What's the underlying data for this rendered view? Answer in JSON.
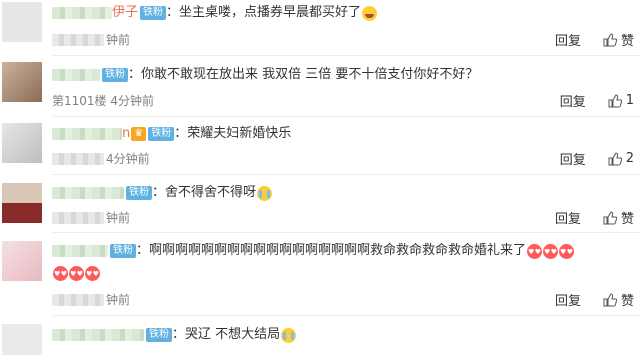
{
  "colors": {
    "badge": "#5eb1e0",
    "vip_badge": "#f6a623",
    "meta_text": "#808080",
    "name_tail": "#eb7350"
  },
  "comments": [
    {
      "name_tail": "伊子",
      "badge": "铁粉",
      "text": "：坐主桌喽，点播券早晨都买好了",
      "emojis": [
        "laugh"
      ],
      "meta": "钟前",
      "reply": "回复",
      "like": "赞"
    },
    {
      "name_tail": "",
      "badge": "铁粉",
      "text": "：你敢不敢现在放出来 我双倍 三倍 要不十倍支付你好不好？",
      "emojis": [],
      "meta": "第1101楼 4分钟前",
      "reply": "回复",
      "like": "1"
    },
    {
      "name_tail": "n",
      "badge": "铁粉",
      "vip": "",
      "text": "：荣耀夫妇新婚快乐",
      "emojis": [],
      "meta": "4分钟前",
      "reply": "回复",
      "like": "2"
    },
    {
      "name_tail": "",
      "badge": "铁粉",
      "text": "：舍不得舍不得呀",
      "emojis": [
        "cry"
      ],
      "meta": "钟前",
      "reply": "回复",
      "like": "赞"
    },
    {
      "name_tail": "",
      "badge": "铁粉",
      "text": "：啊啊啊啊啊啊啊啊啊啊啊啊啊啊啊啊啊救命救命救命救命婚礼来了",
      "emojis": [
        "love",
        "love",
        "love"
      ],
      "emojis2": [
        "love",
        "love",
        "love"
      ],
      "meta": "钟前",
      "reply": "回复",
      "like": "赞"
    },
    {
      "name_tail": "",
      "badge": "铁粉",
      "text": "：哭辽 不想大结局",
      "emojis": [
        "cry"
      ],
      "meta": "",
      "reply": "",
      "like": ""
    }
  ]
}
